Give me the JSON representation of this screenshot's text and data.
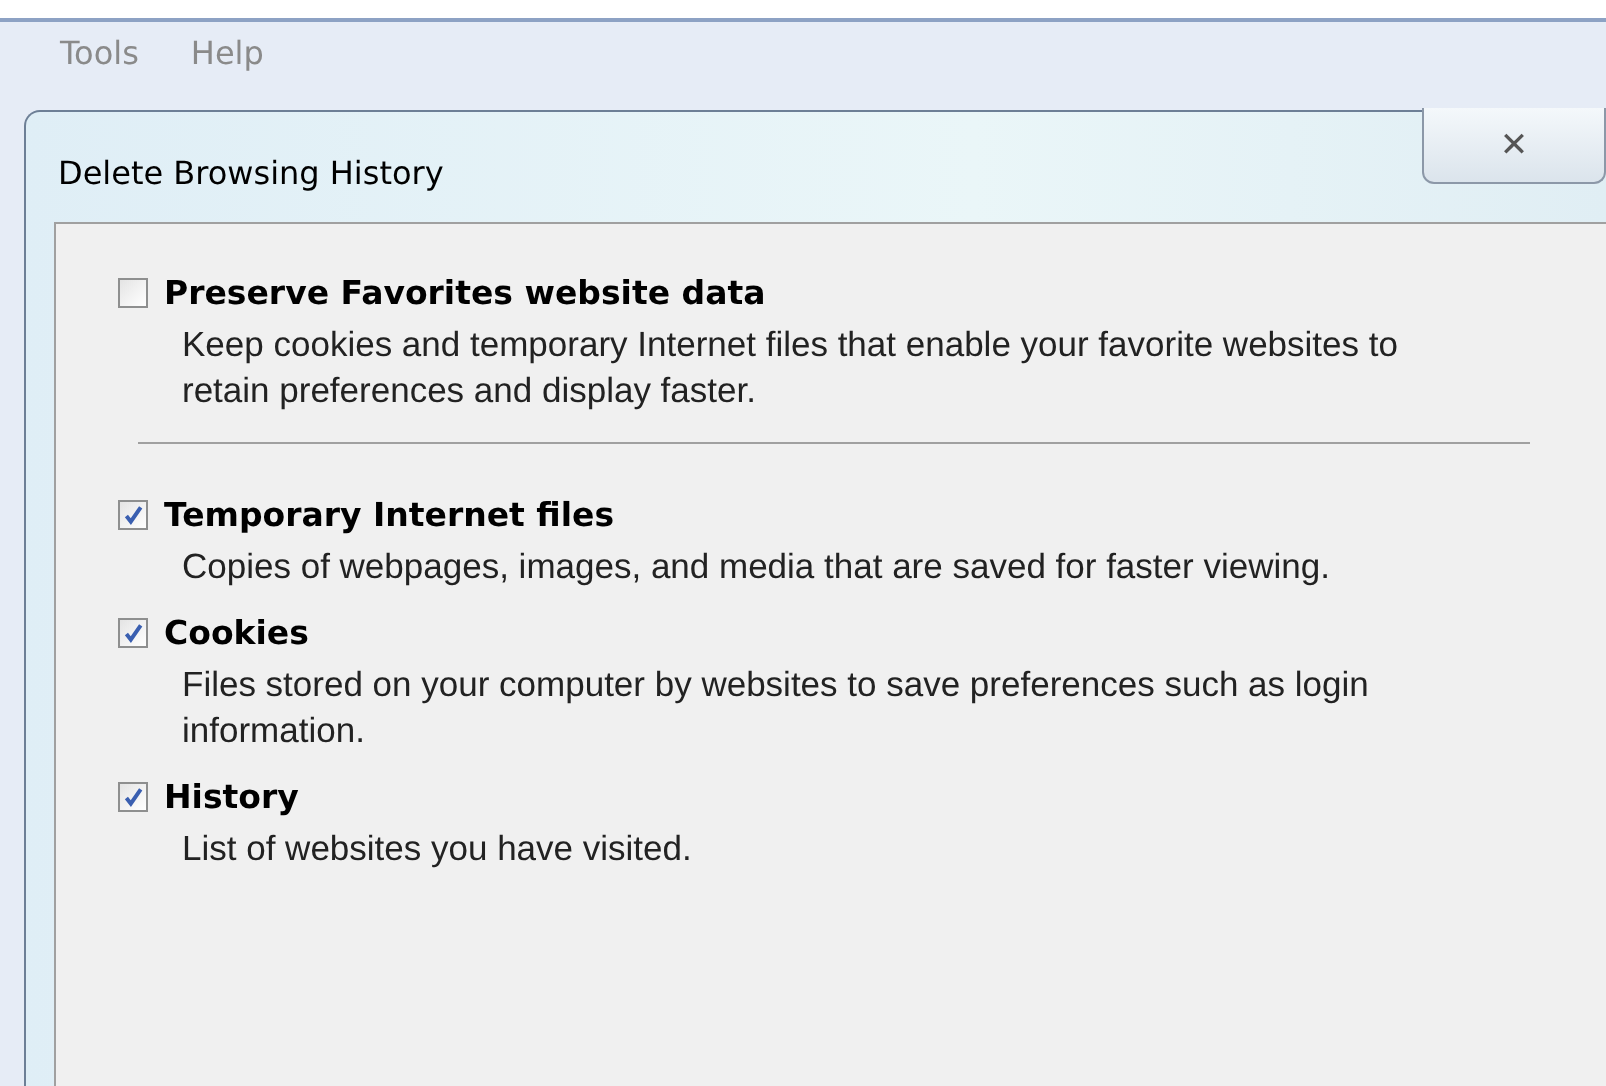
{
  "menu_bar": {
    "items": [
      {
        "label": "Tools"
      },
      {
        "label": "Help"
      }
    ]
  },
  "dialog": {
    "title": "Delete Browsing History",
    "close_glyph": "✕",
    "groups": [
      {
        "items": [
          {
            "label": "Preserve Favorites website data",
            "checked": false,
            "description": "Keep cookies and temporary Internet files that enable your favorite websites to retain preferences and display faster."
          }
        ]
      },
      {
        "items": [
          {
            "label": "Temporary Internet files",
            "checked": true,
            "description": "Copies of webpages, images, and media that are saved for faster viewing."
          },
          {
            "label": "Cookies",
            "checked": true,
            "description": "Files stored on your computer by websites to save preferences such as login information."
          },
          {
            "label": "History",
            "checked": true,
            "description": "List of websites you have visited."
          }
        ]
      }
    ]
  }
}
